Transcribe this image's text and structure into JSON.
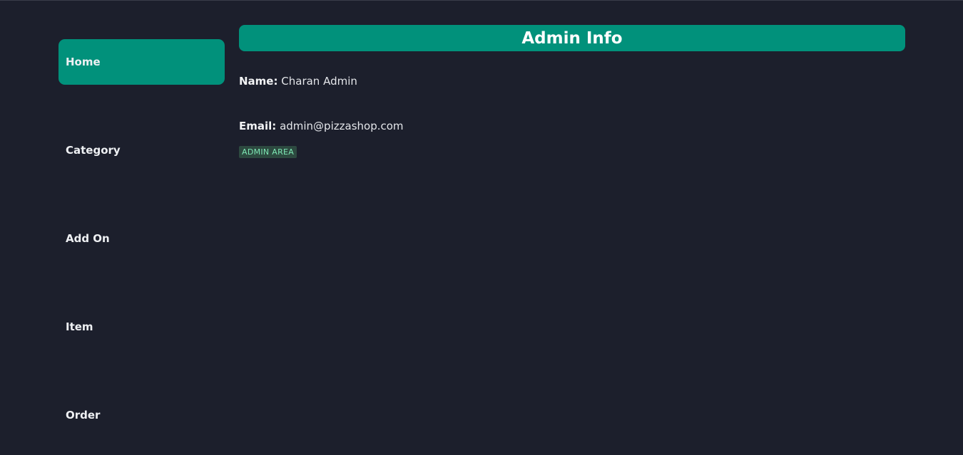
{
  "sidebar": {
    "items": [
      {
        "label": "Home",
        "active": true
      },
      {
        "label": "Category",
        "active": false
      },
      {
        "label": "Add On",
        "active": false
      },
      {
        "label": "Item",
        "active": false
      },
      {
        "label": "Order",
        "active": false
      }
    ]
  },
  "main": {
    "title": "Admin Info",
    "name_label": "Name:",
    "name_value": "Charan Admin",
    "email_label": "Email:",
    "email_value": "admin@pizzashop.com",
    "badge": "ADMIN AREA"
  },
  "colors": {
    "background": "#1c1f2c",
    "accent": "#01917b",
    "badge_bg": "#2d4a40",
    "badge_text": "#7ee8b5"
  }
}
